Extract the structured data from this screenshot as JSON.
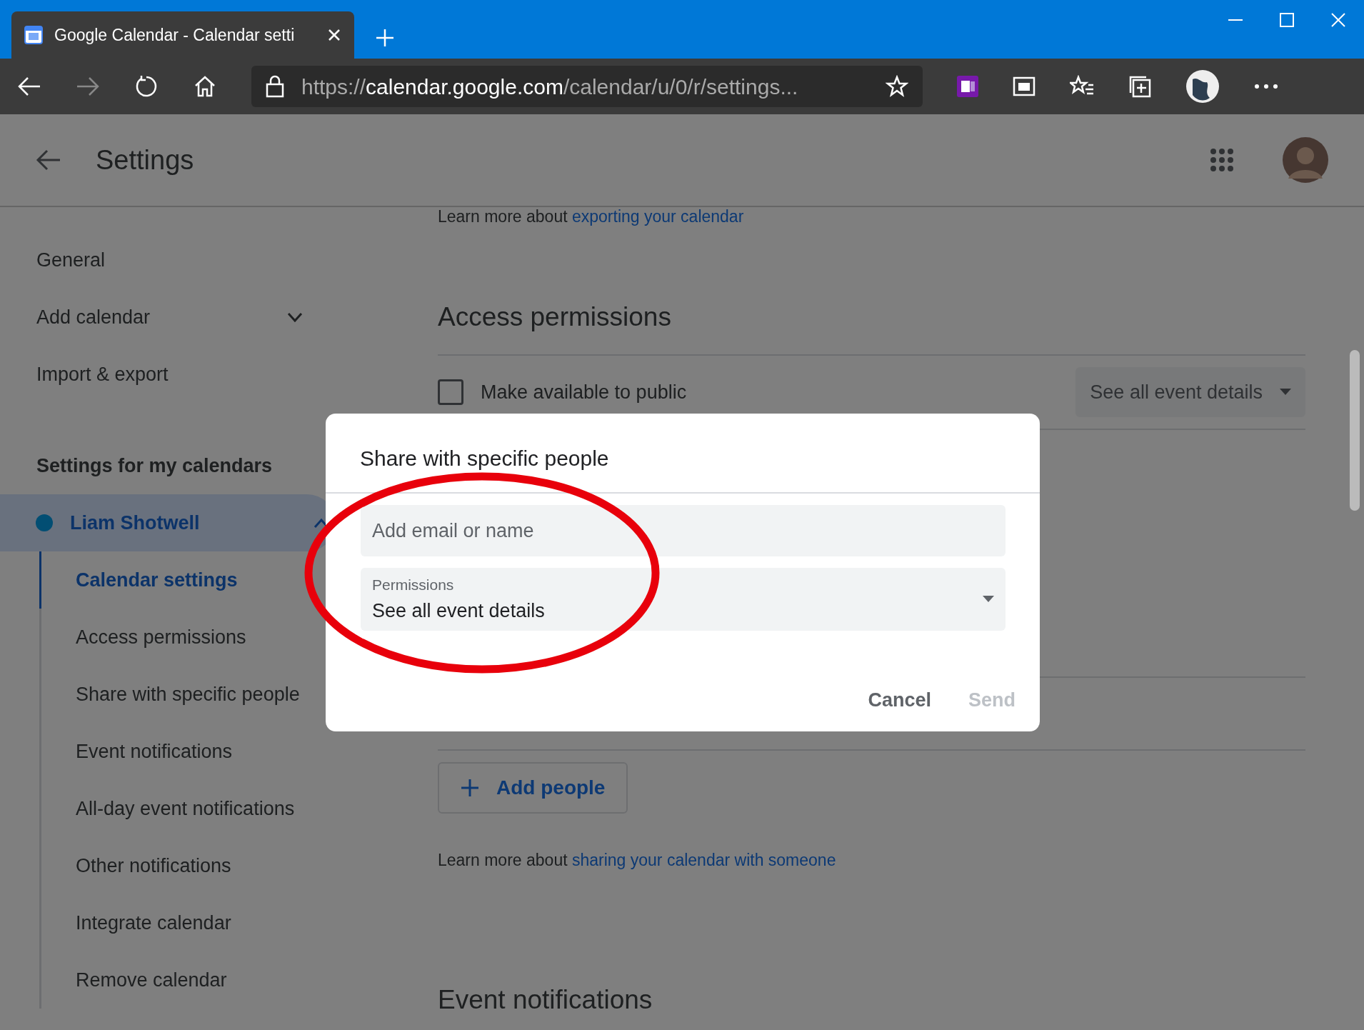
{
  "browser": {
    "tab_title": "Google Calendar - Calendar setti",
    "url_scheme": "https://",
    "url_host": "calendar.google.com",
    "url_path": "/calendar/u/0/r/settings..."
  },
  "header": {
    "title": "Settings"
  },
  "sidebar": {
    "items": [
      {
        "label": "General",
        "kind": "link"
      },
      {
        "label": "Add calendar",
        "kind": "expander",
        "expanded": false
      },
      {
        "label": "Import & export",
        "kind": "link"
      },
      {
        "label": "Settings for my calendars",
        "kind": "section"
      },
      {
        "label": "Liam Shotwell",
        "kind": "calendar",
        "color": "#024e73",
        "expanded": true,
        "children": [
          {
            "label": "Calendar settings",
            "selected": true
          },
          {
            "label": "Access permissions",
            "selected": false
          },
          {
            "label": "Share with specific people",
            "selected": false
          },
          {
            "label": "Event notifications",
            "selected": false
          },
          {
            "label": "All-day event notifications",
            "selected": false
          },
          {
            "label": "Other notifications",
            "selected": false
          },
          {
            "label": "Integrate calendar",
            "selected": false
          },
          {
            "label": "Remove calendar",
            "selected": false
          }
        ]
      }
    ]
  },
  "main": {
    "export_note": "Learn more about ",
    "export_link": "exporting your calendar",
    "access_heading": "Access permissions",
    "public": {
      "label": "Make available to public",
      "checked": false,
      "select": "See all event details"
    },
    "add_people": "Add people",
    "share_note": "Learn more about ",
    "share_link": "sharing your calendar with someone",
    "next_heading": "Event notifications"
  },
  "dialog": {
    "title": "Share with specific people",
    "email_placeholder": "Add email or name",
    "permissions_label": "Permissions",
    "permissions_value": "See all event details",
    "buttons": [
      {
        "label": "Cancel",
        "disabled": false
      },
      {
        "label": "Send",
        "disabled": true
      }
    ]
  }
}
